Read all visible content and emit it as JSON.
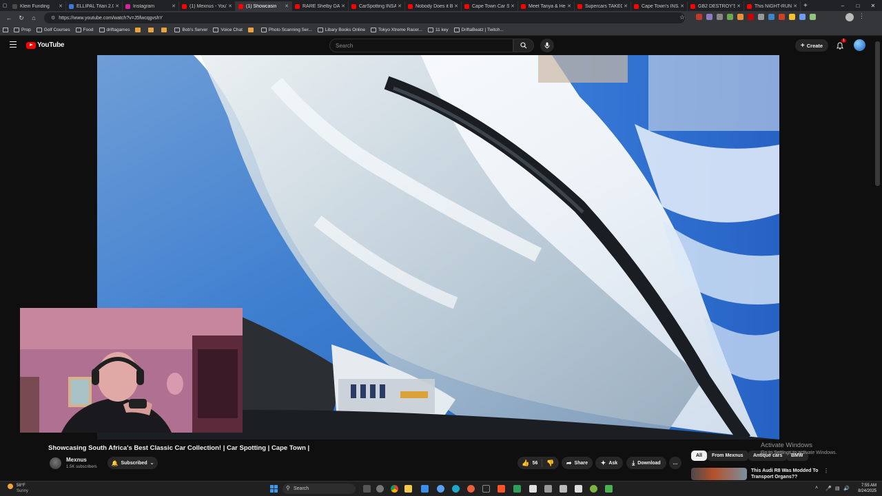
{
  "browser": {
    "tabs": [
      {
        "title": "Klein Funding",
        "color": "#4a4a4a"
      },
      {
        "title": "ELLIPAL Titan 2.0 C",
        "color": "#3a7bd5"
      },
      {
        "title": "Instagram",
        "color": "#d6249f"
      },
      {
        "title": "(1) Mexnus - YouTu",
        "color": "#ff0000"
      },
      {
        "title": "(1) Showcasin",
        "color": "#ff0000"
      },
      {
        "title": "RARE Shelby DAYTI",
        "color": "#ff0000"
      },
      {
        "title": "CarSpotting INSAN",
        "color": "#ff0000"
      },
      {
        "title": "Nobody Does it Be",
        "color": "#ff0000"
      },
      {
        "title": "Cape Town Car Sce",
        "color": "#ff0000"
      },
      {
        "title": "Meet Tanya & Her",
        "color": "#ff0000"
      },
      {
        "title": "Supercars TAKEOVE",
        "color": "#ff0000"
      },
      {
        "title": "Cape Town's INSAN",
        "color": "#ff0000"
      },
      {
        "title": "GB2 DESTROY'S Ca",
        "color": "#ff0000"
      },
      {
        "title": "This NIGHT-RUN W",
        "color": "#ff0000"
      }
    ],
    "active_tab": 4,
    "new_tab": "+",
    "url": "https://www.youtube.com/watch?v=J5fwcqgvshY"
  },
  "bookmarks": [
    {
      "label": "Prop"
    },
    {
      "label": "Golf Courses"
    },
    {
      "label": "Food"
    },
    {
      "label": "driftagames"
    },
    {
      "label": ""
    },
    {
      "label": ""
    },
    {
      "label": ""
    },
    {
      "label": "Bob's Server"
    },
    {
      "label": "Voice Chat"
    },
    {
      "label": ""
    },
    {
      "label": "Photo Scanning Ser..."
    },
    {
      "label": "Libary Books Online"
    },
    {
      "label": "Tokyo Xtreme Racer..."
    },
    {
      "label": "11 key"
    },
    {
      "label": "DriftaBeatz | Twitch..."
    }
  ],
  "youtube": {
    "logo": "YouTube",
    "search_placeholder": "Search",
    "create_label": "Create",
    "notification_count": "1"
  },
  "video": {
    "title": "Showcasing South Africa's Best Classic Car Collection! | Car Spotting | Cape Town |",
    "channel": "Mexnus",
    "subscribers": "1.5K subscribers",
    "subscribed_label": "Subscribed",
    "likes": "56",
    "share_label": "Share",
    "ask_label": "Ask",
    "download_label": "Download",
    "more_label": "…"
  },
  "chips": [
    {
      "label": "All"
    },
    {
      "label": "From Mexnus"
    },
    {
      "label": "Antique cars"
    },
    {
      "label": "BMW"
    }
  ],
  "recommendation": {
    "title": "This Audi R8 Was Modded To Transport Organs??",
    "more": "⋮"
  },
  "watermark": {
    "line1": "Activate Windows",
    "line2": "Go to Settings to activate Windows."
  },
  "taskbar": {
    "weather_temp": "58°F",
    "weather_desc": "Sunny",
    "search_placeholder": "Search",
    "time": "7:55 AM",
    "date": "8/24/2025"
  }
}
